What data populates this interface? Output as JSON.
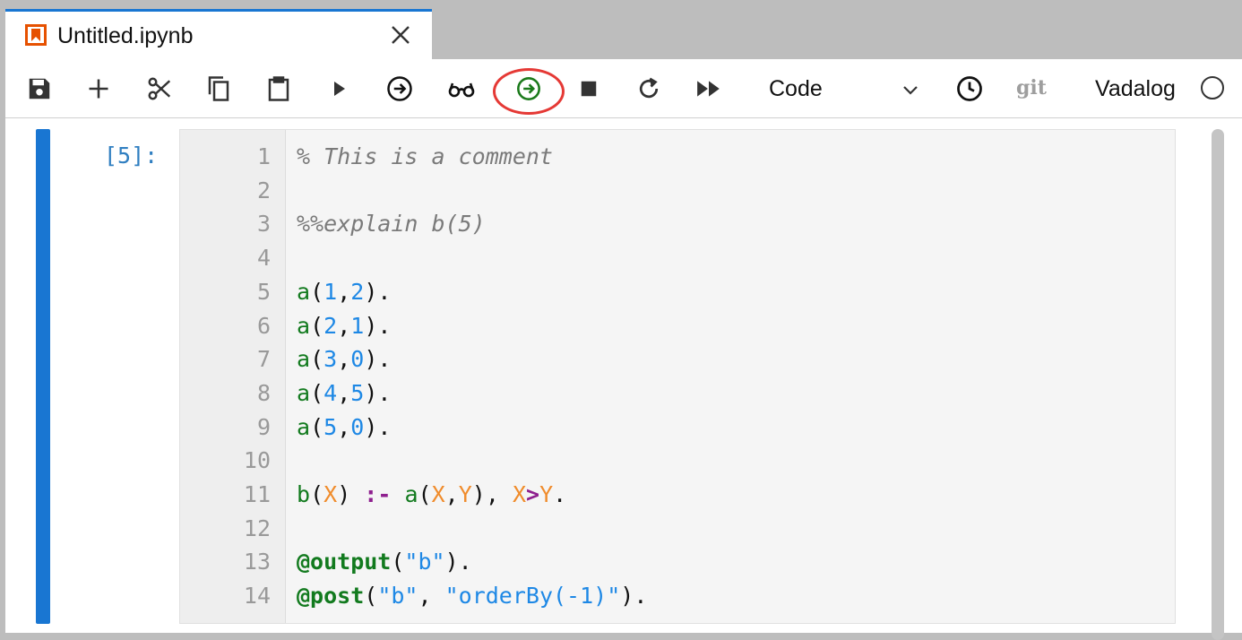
{
  "tab": {
    "title": "Untitled.ipynb",
    "icon": "notebook-icon",
    "accent": "#e65100"
  },
  "toolbar": {
    "buttons": [
      {
        "name": "save-icon"
      },
      {
        "name": "add-cell-icon"
      },
      {
        "name": "cut-icon"
      },
      {
        "name": "copy-icon"
      },
      {
        "name": "paste-icon"
      },
      {
        "name": "run-icon"
      },
      {
        "name": "run-circle-arrow-icon"
      },
      {
        "name": "glasses-icon"
      },
      {
        "name": "run-explain-icon"
      },
      {
        "name": "stop-icon"
      },
      {
        "name": "restart-icon"
      },
      {
        "name": "fast-forward-icon"
      }
    ],
    "cell_type": "Code",
    "git_label": "git",
    "kernel_name": "Vadalog",
    "highlight_color": "#e53935"
  },
  "cell": {
    "prompt": "[5]:",
    "line_numbers": [
      "1",
      "2",
      "3",
      "4",
      "5",
      "6",
      "7",
      "8",
      "9",
      "10",
      "11",
      "12",
      "13",
      "14"
    ],
    "lines": [
      [
        {
          "t": "% This is a comment",
          "c": "cmt"
        }
      ],
      [],
      [
        {
          "t": "%%explain b(5)",
          "c": "cmt"
        }
      ],
      [],
      [
        {
          "t": "a",
          "c": "pred"
        },
        {
          "t": "(",
          "c": "punct"
        },
        {
          "t": "1",
          "c": "num"
        },
        {
          "t": ",",
          "c": "punct"
        },
        {
          "t": "2",
          "c": "num"
        },
        {
          "t": ").",
          "c": "punct"
        }
      ],
      [
        {
          "t": "a",
          "c": "pred"
        },
        {
          "t": "(",
          "c": "punct"
        },
        {
          "t": "2",
          "c": "num"
        },
        {
          "t": ",",
          "c": "punct"
        },
        {
          "t": "1",
          "c": "num"
        },
        {
          "t": ").",
          "c": "punct"
        }
      ],
      [
        {
          "t": "a",
          "c": "pred"
        },
        {
          "t": "(",
          "c": "punct"
        },
        {
          "t": "3",
          "c": "num"
        },
        {
          "t": ",",
          "c": "punct"
        },
        {
          "t": "0",
          "c": "num"
        },
        {
          "t": ").",
          "c": "punct"
        }
      ],
      [
        {
          "t": "a",
          "c": "pred"
        },
        {
          "t": "(",
          "c": "punct"
        },
        {
          "t": "4",
          "c": "num"
        },
        {
          "t": ",",
          "c": "punct"
        },
        {
          "t": "5",
          "c": "num"
        },
        {
          "t": ").",
          "c": "punct"
        }
      ],
      [
        {
          "t": "a",
          "c": "pred"
        },
        {
          "t": "(",
          "c": "punct"
        },
        {
          "t": "5",
          "c": "num"
        },
        {
          "t": ",",
          "c": "punct"
        },
        {
          "t": "0",
          "c": "num"
        },
        {
          "t": ").",
          "c": "punct"
        }
      ],
      [],
      [
        {
          "t": "b",
          "c": "pred"
        },
        {
          "t": "(",
          "c": "punct"
        },
        {
          "t": "X",
          "c": "var"
        },
        {
          "t": ") ",
          "c": "punct"
        },
        {
          "t": ":-",
          "c": "op"
        },
        {
          "t": " ",
          "c": "punct"
        },
        {
          "t": "a",
          "c": "pred"
        },
        {
          "t": "(",
          "c": "punct"
        },
        {
          "t": "X",
          "c": "var"
        },
        {
          "t": ",",
          "c": "punct"
        },
        {
          "t": "Y",
          "c": "var"
        },
        {
          "t": "), ",
          "c": "punct"
        },
        {
          "t": "X",
          "c": "var"
        },
        {
          "t": ">",
          "c": "op"
        },
        {
          "t": "Y",
          "c": "var"
        },
        {
          "t": ".",
          "c": "punct"
        }
      ],
      [],
      [
        {
          "t": "@output",
          "c": "ann"
        },
        {
          "t": "(",
          "c": "punct"
        },
        {
          "t": "\"b\"",
          "c": "str"
        },
        {
          "t": ").",
          "c": "punct"
        }
      ],
      [
        {
          "t": "@post",
          "c": "ann"
        },
        {
          "t": "(",
          "c": "punct"
        },
        {
          "t": "\"b\"",
          "c": "str"
        },
        {
          "t": ", ",
          "c": "punct"
        },
        {
          "t": "\"orderBy(-1)\"",
          "c": "str"
        },
        {
          "t": ").",
          "c": "punct"
        }
      ]
    ]
  }
}
